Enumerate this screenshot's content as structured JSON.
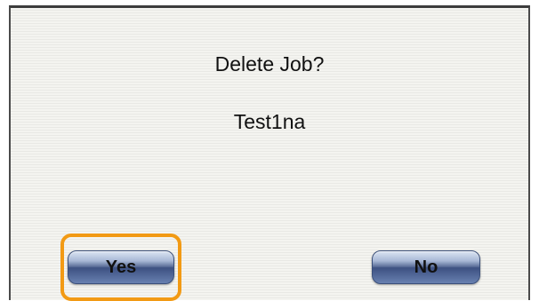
{
  "dialog": {
    "title": "Delete Job?",
    "job_name": "Test1na"
  },
  "buttons": {
    "yes_label": "Yes",
    "no_label": "No"
  },
  "colors": {
    "focus_ring": "#f29a14",
    "button_base": "#3d5182",
    "dialog_background": "#f4f4f0"
  },
  "focus": {
    "selected_button": "Yes"
  }
}
